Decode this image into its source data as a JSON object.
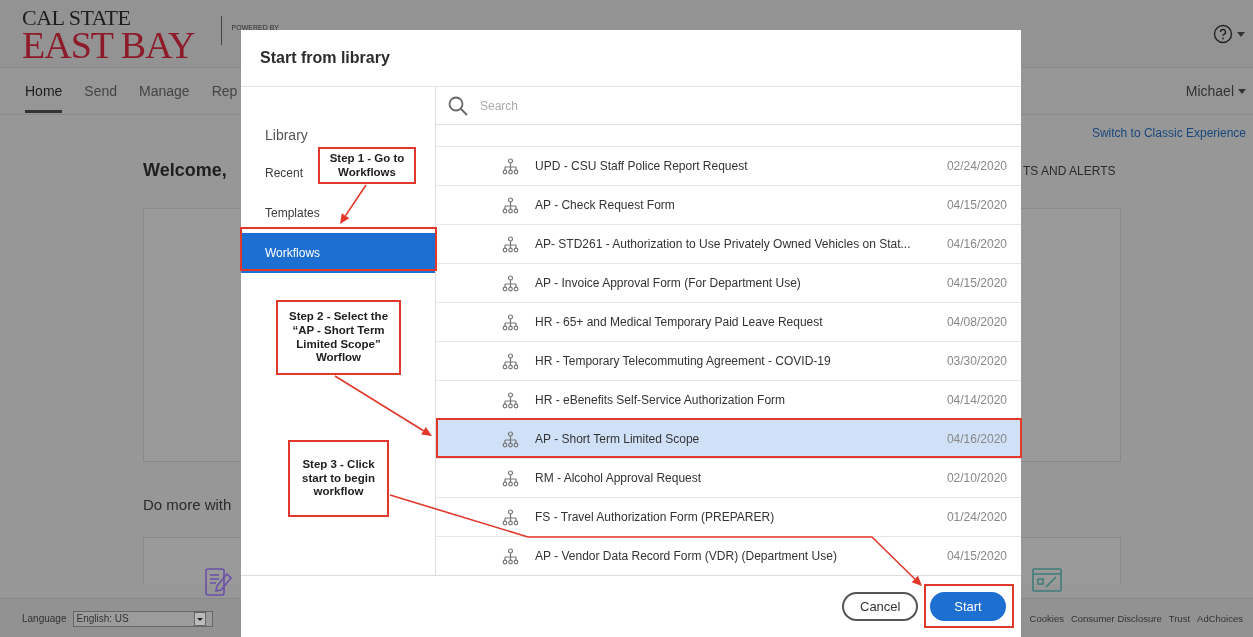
{
  "header": {
    "logo_top": "CAL STATE",
    "logo_bottom": "EAST BAY",
    "powered_by": "POWERED BY"
  },
  "nav": {
    "tabs": [
      {
        "label": "Home",
        "selected": true
      },
      {
        "label": "Send",
        "selected": false
      },
      {
        "label": "Manage",
        "selected": false
      },
      {
        "label": "Rep",
        "selected": false
      }
    ],
    "user": "Michael"
  },
  "page": {
    "classic_link": "Switch to Classic Experience",
    "welcome": "Welcome,",
    "alerts_heading": "TS AND ALERTS",
    "do_more": "Do more with"
  },
  "footer": {
    "language_label": "Language",
    "language_value": "English: US",
    "links": [
      "Cookies",
      "Consumer Disclosure",
      "Trust",
      "AdChoices"
    ]
  },
  "dialog": {
    "title": "Start from library",
    "sidebar": [
      {
        "label": "Library",
        "kind": "heading",
        "selected": false
      },
      {
        "label": "Recent",
        "kind": "item",
        "selected": false
      },
      {
        "label": "Templates",
        "kind": "item",
        "selected": false
      },
      {
        "label": "Workflows",
        "kind": "item",
        "selected": true
      }
    ],
    "search": {
      "placeholder": "Search"
    },
    "rows": [
      {
        "name": "UPD - CSU Staff Police Report Request",
        "date": "02/24/2020",
        "selected": false
      },
      {
        "name": "AP - Check Request Form",
        "date": "04/15/2020",
        "selected": false
      },
      {
        "name": "AP- STD261 - Authorization to Use Privately Owned Vehicles on Stat...",
        "date": "04/16/2020",
        "selected": false
      },
      {
        "name": "AP - Invoice Approval Form (For Department Use)",
        "date": "04/15/2020",
        "selected": false
      },
      {
        "name": "HR - 65+ and Medical Temporary Paid Leave Request",
        "date": "04/08/2020",
        "selected": false
      },
      {
        "name": "HR - Temporary Telecommuting Agreement - COVID-19",
        "date": "03/30/2020",
        "selected": false
      },
      {
        "name": "HR - eBenefits Self-Service Authorization Form",
        "date": "04/14/2020",
        "selected": false
      },
      {
        "name": "AP - Short Term Limited Scope",
        "date": "04/16/2020",
        "selected": true
      },
      {
        "name": "RM - Alcohol Approval Request",
        "date": "02/10/2020",
        "selected": false
      },
      {
        "name": "FS - Travel Authorization Form (PREPARER)",
        "date": "01/24/2020",
        "selected": false
      },
      {
        "name": "AP - Vendor Data Record Form (VDR) (Department Use)",
        "date": "04/15/2020",
        "selected": false
      }
    ],
    "buttons": [
      {
        "label": "Cancel",
        "kind": "secondary"
      },
      {
        "label": "Start",
        "kind": "primary"
      }
    ]
  },
  "annotations": [
    {
      "text": "Step 1 - Go to\nWorkflows"
    },
    {
      "text": "Step 2 - Select the\n“AP - Short Term\nLimited Scope”\nWorflow"
    },
    {
      "text": "Step 3 - Click\nstart to begin\nworkflow"
    }
  ]
}
